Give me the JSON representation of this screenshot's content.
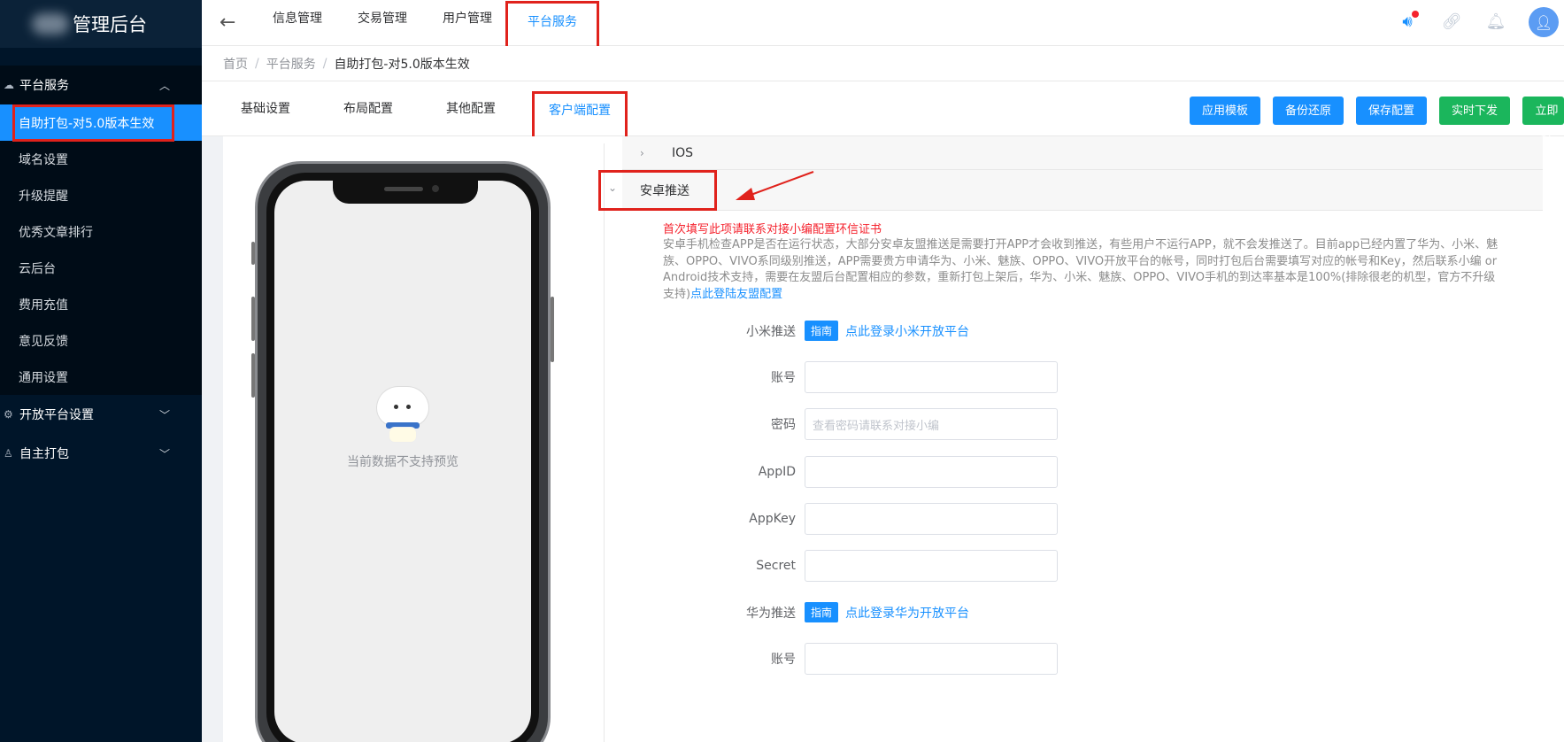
{
  "app": {
    "title": "管理后台"
  },
  "sidebar": {
    "group_platform": {
      "label": "平台服务"
    },
    "items": [
      {
        "label": "自助打包-对5.0版本生效",
        "active": true
      },
      {
        "label": "域名设置"
      },
      {
        "label": "升级提醒"
      },
      {
        "label": "优秀文章排行"
      },
      {
        "label": "云后台"
      },
      {
        "label": "费用充值"
      },
      {
        "label": "意见反馈"
      },
      {
        "label": "通用设置"
      }
    ],
    "group_open": {
      "label": "开放平台设置"
    },
    "group_pack": {
      "label": "自主打包"
    }
  },
  "topnav": {
    "items": [
      {
        "label": "信息管理"
      },
      {
        "label": "交易管理"
      },
      {
        "label": "用户管理"
      },
      {
        "label": "平台服务",
        "active": true
      }
    ]
  },
  "breadcrumb": {
    "home": "首页",
    "section": "平台服务",
    "current": "自助打包-对5.0版本生效"
  },
  "tabs": [
    {
      "label": "基础设置"
    },
    {
      "label": "布局配置"
    },
    {
      "label": "其他配置"
    },
    {
      "label": "客户端配置",
      "active": true
    }
  ],
  "toolbar": {
    "apply_template": "应用模板",
    "backup_restore": "备份还原",
    "save_config": "保存配置",
    "realtime_push": "实时下发",
    "instant_pack": "立即打"
  },
  "preview": {
    "empty_text": "当前数据不支持预览"
  },
  "collapse": {
    "ios_label": "IOS",
    "android_label": "安卓推送"
  },
  "android": {
    "warning": "首次填写此项请联系对接小编配置环信证书",
    "description": "安卓手机检查APP是否在运行状态，大部分安卓友盟推送是需要打开APP才会收到推送，有些用户不运行APP，就不会发推送了。目前app已经内置了华为、小米、魅族、OPPO、VIVO系同级别推送，APP需要贵方申请华为、小米、魅族、OPPO、VIVO开放平台的帐号，同时打包后台需要填写对应的帐号和Key，然后联系小编 or Android技术支持，需要在友盟后台配置相应的参数，重新打包上架后，华为、小米、魅族、OPPO、VIVO手机的到达率基本是100%(排除很老的机型，官方不升级支持)",
    "umeng_link": "点此登陆友盟配置"
  },
  "form": {
    "xiaomi_label": "小米推送",
    "guide_tag": "指南",
    "xiaomi_link": "点此登录小米开放平台",
    "account_label": "账号",
    "password_label": "密码",
    "password_placeholder": "查看密码请联系对接小编",
    "appid_label": "AppID",
    "appkey_label": "AppKey",
    "secret_label": "Secret",
    "huawei_label": "华为推送",
    "huawei_link": "点此登录华为开放平台",
    "account2_label": "账号"
  },
  "colors": {
    "primary": "#1890ff",
    "success": "#1bb65c",
    "danger": "#e0221c",
    "sidebar": "#001529"
  }
}
